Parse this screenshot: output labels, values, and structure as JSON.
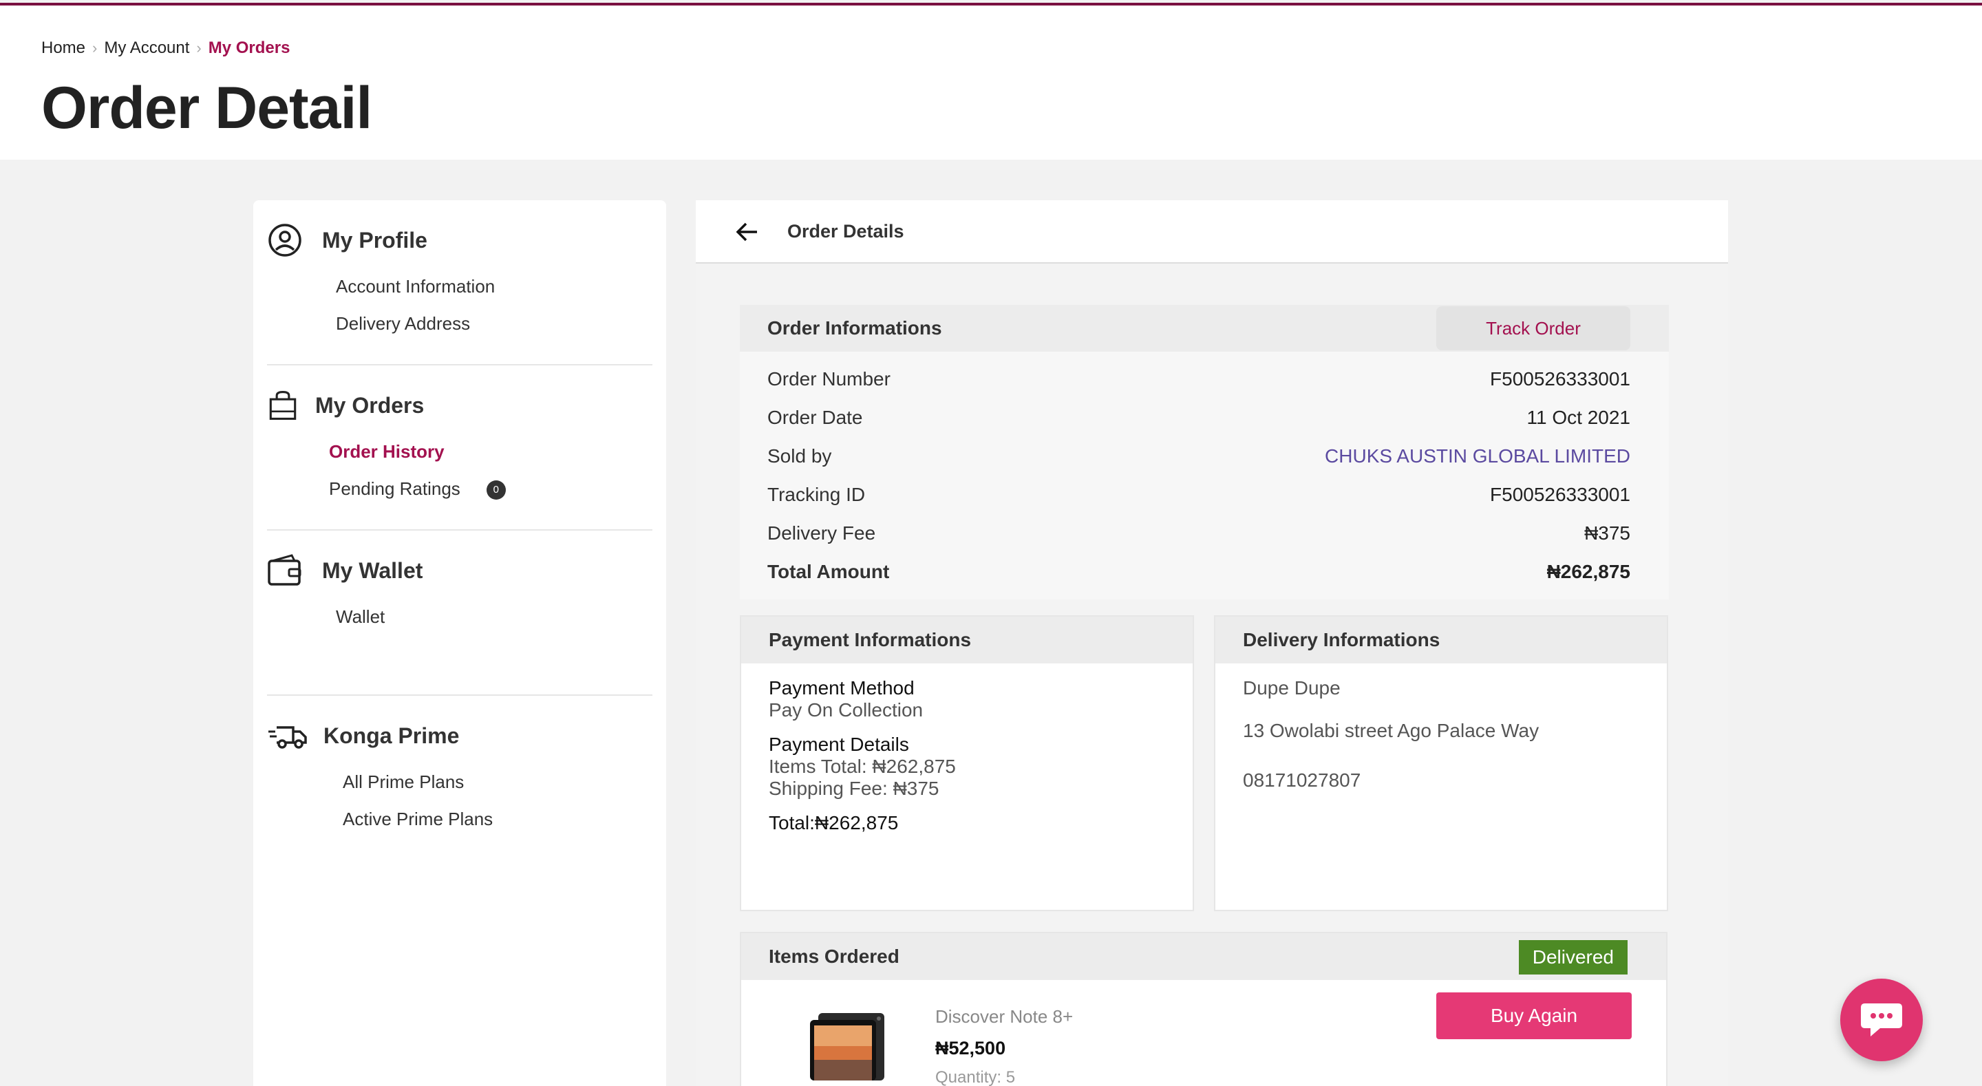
{
  "breadcrumb": {
    "items": [
      "Home",
      "My Account",
      "My Orders"
    ]
  },
  "page": {
    "title": "Order Detail"
  },
  "sidebar": {
    "profile": {
      "title": "My Profile",
      "items": [
        "Account Information",
        "Delivery Address"
      ]
    },
    "orders": {
      "title": "My Orders",
      "items": [
        "Order History",
        "Pending Ratings"
      ],
      "pending_count": "0"
    },
    "wallet": {
      "title": "My Wallet",
      "items": [
        "Wallet"
      ]
    },
    "prime": {
      "title": "Konga Prime",
      "items": [
        "All Prime Plans",
        "Active Prime Plans"
      ]
    }
  },
  "main": {
    "title": "Order Details",
    "order_info": {
      "title": "Order Informations",
      "track_label": "Track Order",
      "rows": [
        {
          "label": "Order Number",
          "value": "F500526333001"
        },
        {
          "label": "Order Date",
          "value": "11 Oct 2021"
        },
        {
          "label": "Sold by",
          "value": "CHUKS AUSTIN GLOBAL LIMITED"
        },
        {
          "label": "Tracking ID",
          "value": "F500526333001"
        },
        {
          "label": "Delivery Fee",
          "value": "₦375"
        },
        {
          "label": "Total Amount",
          "value": "₦262,875"
        }
      ]
    },
    "payment_info": {
      "title": "Payment Informations",
      "method_label": "Payment Method",
      "method_value": "Pay On Collection",
      "details_label": "Payment Details",
      "items_total": "Items Total: ₦262,875",
      "shipping_fee": "Shipping Fee: ₦375",
      "total": "Total:₦262,875"
    },
    "delivery_info": {
      "title": "Delivery Informations",
      "name": "Dupe Dupe",
      "address": "13 Owolabi street Ago Palace Way",
      "phone": "08171027807"
    },
    "items_ordered": {
      "title": "Items Ordered",
      "status": "Delivered",
      "status_color": "#4d8a24",
      "product": {
        "name": "Discover Note 8+",
        "price": "₦52,500",
        "quantity": "Quantity: 5"
      },
      "buy_again_label": "Buy Again"
    }
  },
  "colors": {
    "brand": "#a3114f",
    "accent_button": "#e53975",
    "link": "#5b4aa0"
  },
  "icons": {
    "profile": "user-circle-icon",
    "orders": "shopping-bag-icon",
    "wallet": "wallet-icon",
    "prime": "delivery-truck-icon",
    "back": "arrow-left-icon",
    "chat": "chat-bubble-icon"
  }
}
